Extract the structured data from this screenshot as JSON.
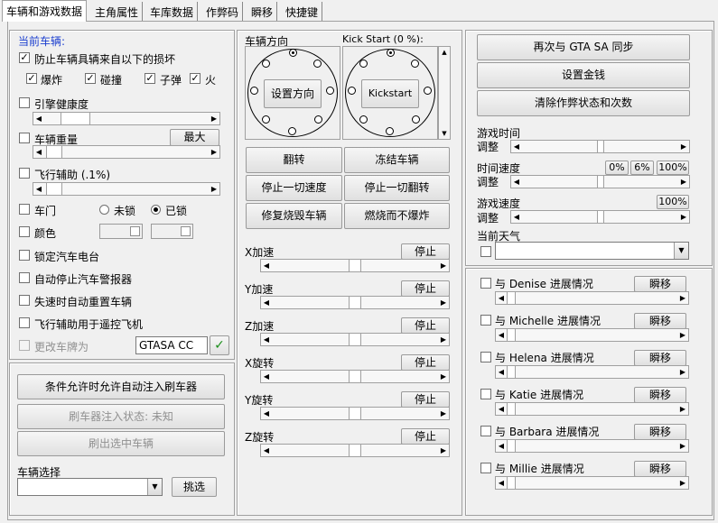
{
  "tabs": [
    "车辆和游戏数据",
    "主角属性",
    "车库数据",
    "作弊码",
    "瞬移",
    "快捷键"
  ],
  "vehicle": {
    "section_label": "当前车辆:",
    "protect_label": "防止车辆具辆来自以下的损坏",
    "protect_checked": true,
    "damage": {
      "explosion": "爆炸",
      "collision": "碰撞",
      "bullet": "子弹",
      "fire": "火"
    },
    "engine_health": "引擎健康度",
    "weight": "车辆重量",
    "weight_max_btn": "最大",
    "flight_assist": "飞行辅助 (.1%)",
    "door": "车门",
    "unlocked": "未锁",
    "locked": "已锁",
    "door_state": "locked",
    "color": "颜色",
    "lock_radio": "锁定汽车电台",
    "auto_stop_alarm": "自动停止汽车警报器",
    "auto_reset": "失速时自动重置车辆",
    "flight_remote": "飞行辅助用于遥控飞机",
    "change_plate": "更改车牌为",
    "plate_value": "GTASA CC",
    "check_mark": "✓"
  },
  "injector": {
    "auto_inject_btn": "条件允许时允许自动注入刷车器",
    "status_btn": "刷车器注入状态: 未知",
    "spawn_btn": "刷出选中车辆",
    "select_label": "车辆选择",
    "pick_btn": "挑选"
  },
  "direction": {
    "label": "车辆方向",
    "set_btn": "设置方向",
    "kick_label": "Kick Start (0 %):",
    "kick_btn": "Kickstart"
  },
  "actions": {
    "flip": "翻转",
    "freeze": "冻结车辆",
    "stop_speed": "停止一切速度",
    "stop_flip": "停止一切翻转",
    "repair": "修复烧毁车辆",
    "burn": "燃烧而不爆炸"
  },
  "forces": [
    {
      "label": "X加速",
      "btn": "停止"
    },
    {
      "label": "Y加速",
      "btn": "停止"
    },
    {
      "label": "Z加速",
      "btn": "停止"
    },
    {
      "label": "X旋转",
      "btn": "停止"
    },
    {
      "label": "Y旋转",
      "btn": "停止"
    },
    {
      "label": "Z旋转",
      "btn": "停止"
    }
  ],
  "game": {
    "sync_btn": "再次与 GTA SA 同步",
    "money_btn": "设置金钱",
    "clear_btn": "清除作弊状态和次数",
    "time_label": "游戏时间",
    "adjust": "调整",
    "speed_label": "时间速度",
    "pct0": "0%",
    "pct6": "6%",
    "pct100": "100%",
    "gamespeed_label": "游戏速度",
    "gs100": "100%",
    "weather_label": "当前天气"
  },
  "girls": [
    {
      "label": "与 Denise 进展情况",
      "btn": "瞬移"
    },
    {
      "label": "与 Michelle 进展情况",
      "btn": "瞬移"
    },
    {
      "label": "与 Helena 进展情况",
      "btn": "瞬移"
    },
    {
      "label": "与 Katie 进展情况",
      "btn": "瞬移"
    },
    {
      "label": "与 Barbara 进展情况",
      "btn": "瞬移"
    },
    {
      "label": "与 Millie 进展情况",
      "btn": "瞬移"
    }
  ]
}
